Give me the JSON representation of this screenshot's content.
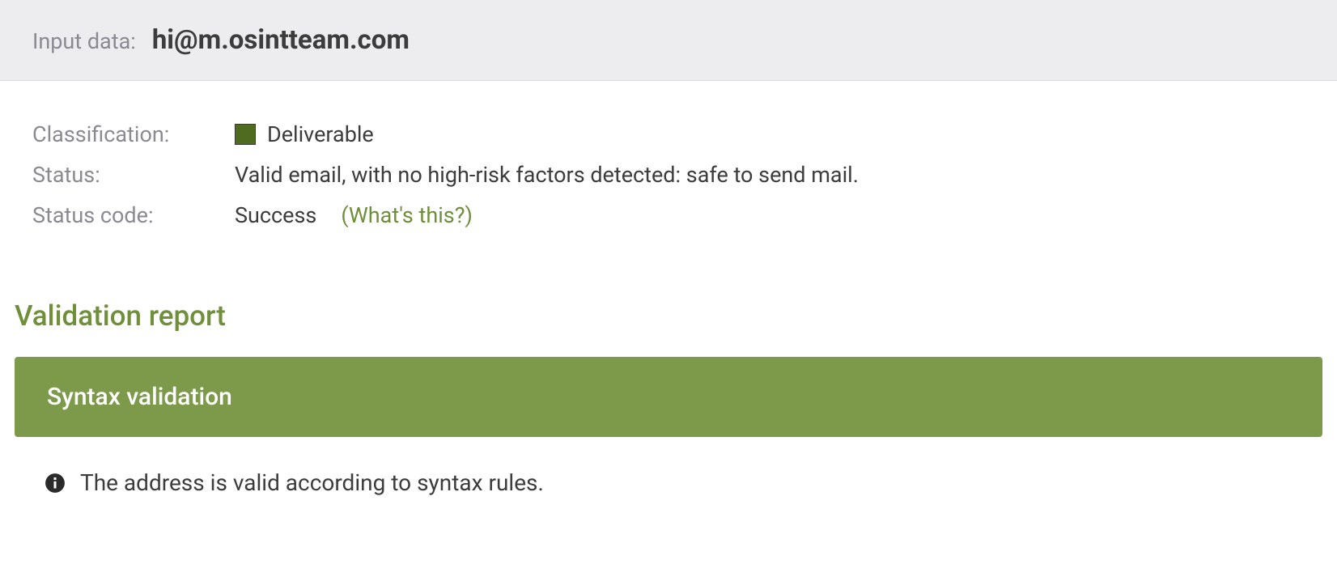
{
  "colors": {
    "olive": "#6f8f3a",
    "olive_panel": "#7d9a4b",
    "swatch_deliverable": "#4e6b1f"
  },
  "input": {
    "label": "Input data:",
    "value": "hi@m.osintteam.com"
  },
  "summary": {
    "classification_label": "Classification:",
    "classification_value": "Deliverable",
    "status_label": "Status:",
    "status_value": "Valid email, with no high-risk factors detected: safe to send mail.",
    "status_code_label": "Status code:",
    "status_code_value": "Success",
    "help_link": "(What's this?)"
  },
  "report": {
    "title": "Validation report",
    "syntax": {
      "header": "Syntax validation",
      "message": "The address is valid according to syntax rules."
    }
  }
}
